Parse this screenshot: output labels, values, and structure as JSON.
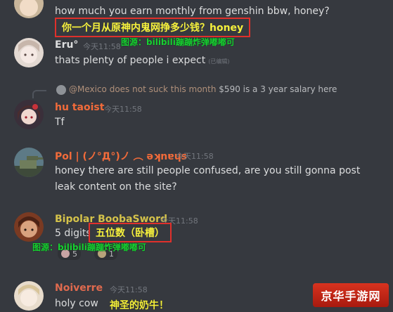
{
  "messages": [
    {
      "text": "how much you earn monthly from genshin bbw, honey?"
    },
    {
      "author": "Eru°",
      "time": "今天11:58",
      "text": "thats  plenty of people i expect",
      "edited": "(已编辑)"
    },
    {
      "reply_mention": "@Mexico does not suck this month",
      "reply_text": "$590 is a 3 year salary here",
      "author": "hu taoist",
      "time": "今天11:58",
      "text": "Tf"
    },
    {
      "author": "Pol | (ノ°Д°)ノ ︵ ǝʞnɐɥs",
      "time": "今天11:58",
      "text_line1": "honey there are still people confused, are you still gonna post",
      "text_line2": "leak content on the site?"
    },
    {
      "author": "Bipolar BoobaSword",
      "time": "今天11:58",
      "text": "5 digits",
      "reactions": [
        {
          "count": "5"
        },
        {
          "count": "1"
        }
      ]
    },
    {
      "author": "Noiverre",
      "time": "今天11:58",
      "text": "holy cow"
    }
  ],
  "overlays": {
    "caption1": "你一个月从原神内鬼网挣多少钱？honey",
    "source1": "图源：bilibili蹦蹦炸弹嘟嘟可",
    "caption2": "五位数（卧槽）",
    "source2": "图源：bilibili蹦蹦炸弹嘟嘟可",
    "caption3": "神圣的奶牛！"
  },
  "watermark": "京华手游网",
  "colors": {
    "background": "#36393f",
    "eru": "#dcddde",
    "hu_taoist": "#f26b3a",
    "pol": "#f26b3a",
    "bipolar": "#d4c24a",
    "noiverre": "#e06a4e",
    "caption_text": "#f5f03c",
    "caption_border": "#e0302b",
    "source_text": "#18d232"
  }
}
